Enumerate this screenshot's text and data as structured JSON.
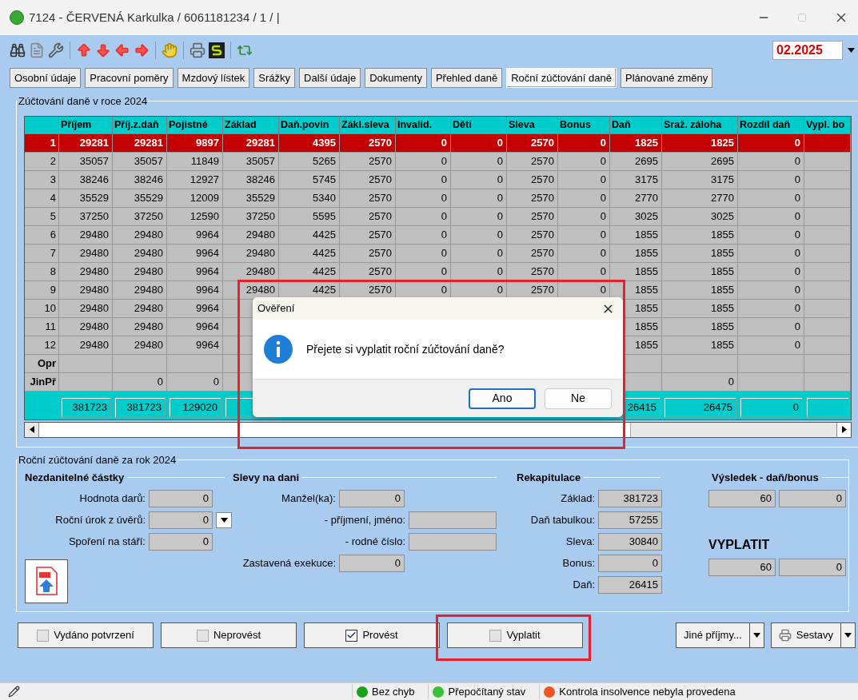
{
  "window": {
    "title": "7124 - ČERVENÁ Karkulka / 6061181234 / 1 / |"
  },
  "toolbar": {
    "period": "02.2025"
  },
  "tabs": [
    {
      "label": "Osobní údaje",
      "selected": false
    },
    {
      "label": "Pracovní poměry",
      "selected": false
    },
    {
      "label": "Mzdový lístek",
      "selected": false
    },
    {
      "label": "Srážky",
      "selected": false
    },
    {
      "label": "Další údaje",
      "selected": false
    },
    {
      "label": "Dokumenty",
      "selected": false
    },
    {
      "label": "Přehled daně",
      "selected": false
    },
    {
      "label": "Roční zúčtování daně",
      "selected": true
    },
    {
      "label": "Plánované změny",
      "selected": false
    }
  ],
  "tax_table": {
    "title": "Zúčtování daně v roce 2024",
    "columns": [
      "Příjem",
      "Příj.z.daň",
      "Pojistné",
      "Základ",
      "Daň.povin",
      "Zákl.sleva",
      "Invalid.",
      "Děti",
      "Sleva",
      "Bonus",
      "Daň",
      "Sraž. záloha",
      "Rozdíl daň",
      "Vypl. bo"
    ],
    "rows": [
      {
        "label": "1",
        "kind": "month",
        "selected": true,
        "cells": {
          "income": "29281",
          "taxed_income": "29281",
          "insurance": "9897",
          "base": "29281",
          "tax_liability": "4395",
          "basic_discount": "2570",
          "disability": "0",
          "children": "0",
          "discount": "2570",
          "bonus": "0",
          "tax": "1825",
          "advance_withheld": "1825",
          "tax_difference": "0"
        }
      },
      {
        "label": "2",
        "kind": "month",
        "selected": false,
        "cells": {
          "income": "35057",
          "taxed_income": "35057",
          "insurance": "11849",
          "base": "35057",
          "tax_liability": "5265",
          "basic_discount": "2570",
          "disability": "0",
          "children": "0",
          "discount": "2570",
          "bonus": "0",
          "tax": "2695",
          "advance_withheld": "2695",
          "tax_difference": "0"
        }
      },
      {
        "label": "3",
        "kind": "month",
        "selected": false,
        "cells": {
          "income": "38246",
          "taxed_income": "38246",
          "insurance": "12927",
          "base": "38246",
          "tax_liability": "5745",
          "basic_discount": "2570",
          "disability": "0",
          "children": "0",
          "discount": "2570",
          "bonus": "0",
          "tax": "3175",
          "advance_withheld": "3175",
          "tax_difference": "0"
        }
      },
      {
        "label": "4",
        "kind": "month",
        "selected": false,
        "cells": {
          "income": "35529",
          "taxed_income": "35529",
          "insurance": "12009",
          "base": "35529",
          "tax_liability": "5340",
          "basic_discount": "2570",
          "disability": "0",
          "children": "0",
          "discount": "2570",
          "bonus": "0",
          "tax": "2770",
          "advance_withheld": "2770",
          "tax_difference": "0"
        }
      },
      {
        "label": "5",
        "kind": "month",
        "selected": false,
        "cells": {
          "income": "37250",
          "taxed_income": "37250",
          "insurance": "12590",
          "base": "37250",
          "tax_liability": "5595",
          "basic_discount": "2570",
          "disability": "0",
          "children": "0",
          "discount": "2570",
          "bonus": "0",
          "tax": "3025",
          "advance_withheld": "3025",
          "tax_difference": "0"
        }
      },
      {
        "label": "6",
        "kind": "month",
        "selected": false,
        "cells": {
          "income": "29480",
          "taxed_income": "29480",
          "insurance": "9964",
          "base": "29480",
          "tax_liability": "4425",
          "basic_discount": "2570",
          "disability": "0",
          "children": "0",
          "discount": "2570",
          "bonus": "0",
          "tax": "1855",
          "advance_withheld": "1855",
          "tax_difference": "0"
        }
      },
      {
        "label": "7",
        "kind": "month",
        "selected": false,
        "cells": {
          "income": "29480",
          "taxed_income": "29480",
          "insurance": "9964",
          "base": "29480",
          "tax_liability": "4425",
          "basic_discount": "2570",
          "disability": "0",
          "children": "0",
          "discount": "2570",
          "bonus": "0",
          "tax": "1855",
          "advance_withheld": "1855",
          "tax_difference": "0"
        }
      },
      {
        "label": "8",
        "kind": "month",
        "selected": false,
        "cells": {
          "income": "29480",
          "taxed_income": "29480",
          "insurance": "9964",
          "base": "29480",
          "tax_liability": "4425",
          "basic_discount": "2570",
          "disability": "0",
          "children": "0",
          "discount": "2570",
          "bonus": "0",
          "tax": "1855",
          "advance_withheld": "1855",
          "tax_difference": "0"
        }
      },
      {
        "label": "9",
        "kind": "month",
        "selected": false,
        "cells": {
          "income": "29480",
          "taxed_income": "29480",
          "insurance": "9964",
          "base": "29480",
          "tax_liability": "4425",
          "basic_discount": "2570",
          "disability": "0",
          "children": "0",
          "discount": "2570",
          "bonus": "0",
          "tax": "1855",
          "advance_withheld": "1855",
          "tax_difference": "0"
        }
      },
      {
        "label": "10",
        "kind": "month",
        "selected": false,
        "cells": {
          "income": "29480",
          "taxed_income": "29480",
          "insurance": "9964",
          "tax": "1855",
          "advance_withheld": "1855",
          "tax_difference": "0"
        }
      },
      {
        "label": "11",
        "kind": "month",
        "selected": false,
        "cells": {
          "income": "29480",
          "taxed_income": "29480",
          "insurance": "9964",
          "tax": "1855",
          "advance_withheld": "1855",
          "tax_difference": "0"
        }
      },
      {
        "label": "12",
        "kind": "month",
        "selected": false,
        "cells": {
          "income": "29480",
          "taxed_income": "29480",
          "insurance": "9964",
          "tax": "1855",
          "advance_withheld": "1855",
          "tax_difference": "0"
        }
      },
      {
        "label": "Opr",
        "kind": "extra",
        "selected": false
      },
      {
        "label": "JinPř",
        "kind": "extra",
        "selected": false,
        "cells": {
          "taxed_income": "0",
          "insurance": "0",
          "advance_withheld": "0"
        }
      }
    ],
    "total": {
      "income": "381723",
      "taxed_income": "381723",
      "insurance": "129020",
      "tax": "26415",
      "advance_withheld": "26475",
      "tax_difference": "0"
    }
  },
  "dialog": {
    "title": "Ověření",
    "message": "Přejete si vyplatit roční zúčtování daně?",
    "buttons": [
      {
        "label": "Ano",
        "selected": true
      },
      {
        "label": "Ne",
        "selected": false
      }
    ]
  },
  "settlement": {
    "title": "Roční zúčtování daně za rok 2024",
    "non_taxable": {
      "heading": "Nezdanitelné částky",
      "fields": [
        {
          "label": "Hodnota darů:",
          "value": "0",
          "kind": "field"
        },
        {
          "label": "Roční úrok z úvěrů:",
          "value": "0",
          "kind": "dropdown"
        },
        {
          "label": "Spoření na stáří:",
          "value": "0",
          "kind": "field"
        }
      ]
    },
    "discounts": {
      "heading": "Slevy na dani",
      "fields": [
        {
          "label": "Manžel(ka):",
          "value": "0",
          "kind": "short"
        },
        {
          "label": "- příjmení, jméno:",
          "kind": "wide"
        },
        {
          "label": "- rodné číslo:",
          "kind": "wide"
        },
        {
          "label": "Zastavená exekuce:",
          "value": "0",
          "kind": "short"
        }
      ]
    },
    "recap": {
      "heading": "Rekapitulace",
      "fields": [
        {
          "label": "Základ:",
          "value": "381723"
        },
        {
          "label": "Daň tabulkou:",
          "value": "57255"
        },
        {
          "label": "Sleva:",
          "value": "30840"
        },
        {
          "label": "Bonus:",
          "value": "0"
        },
        {
          "label": "Daň:",
          "value": "26415"
        }
      ]
    },
    "result": {
      "heading": "Výsledek - daň/bonus",
      "values": [
        "60",
        "0"
      ],
      "payout_label": "VYPLATIT",
      "payout_values": [
        "60",
        "0"
      ]
    }
  },
  "actions": [
    {
      "label": "Vydáno potvrzení",
      "checked": false
    },
    {
      "label": "Neprovést",
      "checked": false
    },
    {
      "label": "Provést",
      "checked": true
    },
    {
      "label": "Vyplatit",
      "checked": false
    }
  ],
  "menus": [
    {
      "label": "Jiné příjmy...",
      "kind": "plain"
    },
    {
      "label": "Sestavy",
      "kind": "printer"
    }
  ],
  "status_bar": [
    {
      "text": "Bez chyb",
      "kind": "info"
    },
    {
      "text": "Přepočítaný stav",
      "kind": "ok"
    },
    {
      "text": "Kontrola insolvence nebyla provedena",
      "kind": "warning"
    }
  ]
}
